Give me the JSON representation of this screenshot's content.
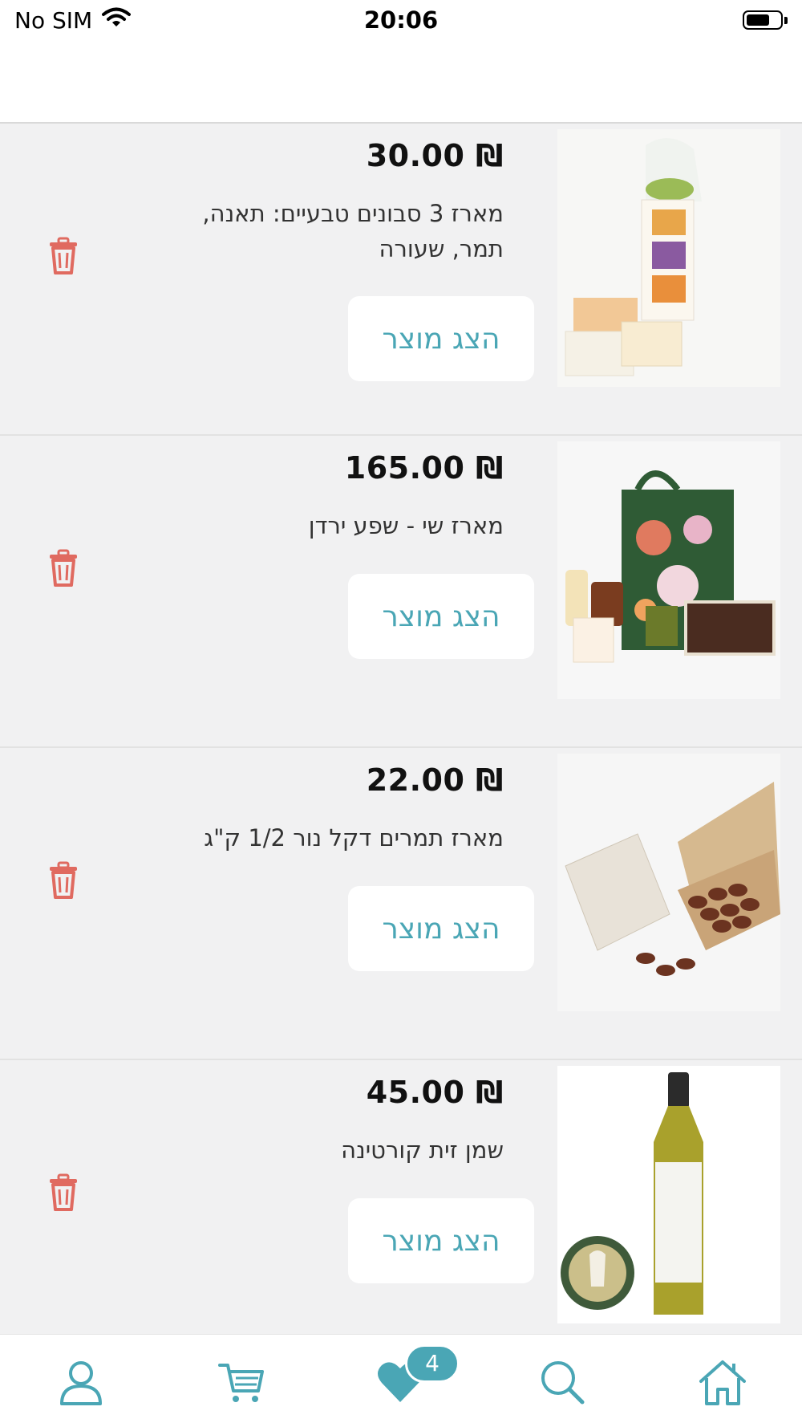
{
  "status_bar": {
    "carrier": "No SIM",
    "time": "20:06",
    "battery_level": 0.7
  },
  "colors": {
    "accent": "#4aa6b5",
    "delete": "#e06a60",
    "list_background": "#f1f1f2"
  },
  "favorites": {
    "items": [
      {
        "price": "₪ 30.00",
        "title": "מארז 3 סבונים טבעיים: תאנה, תמר, שעורה",
        "button_label": "הצג מוצר"
      },
      {
        "price": "₪ 165.00",
        "title": "מארז שי - שפע ירדן",
        "button_label": "הצג מוצר"
      },
      {
        "price": "₪ 22.00",
        "title": "מארז תמרים דקל נור 1/2 ק\"ג",
        "button_label": "הצג מוצר"
      },
      {
        "price": "₪ 45.00",
        "title": "שמן זית קורטינה",
        "button_label": "הצג מוצר"
      }
    ]
  },
  "tab_bar": {
    "tabs": [
      "profile-icon",
      "cart-icon",
      "heart-icon",
      "search-icon",
      "home-icon"
    ],
    "favorites_badge": "4"
  }
}
